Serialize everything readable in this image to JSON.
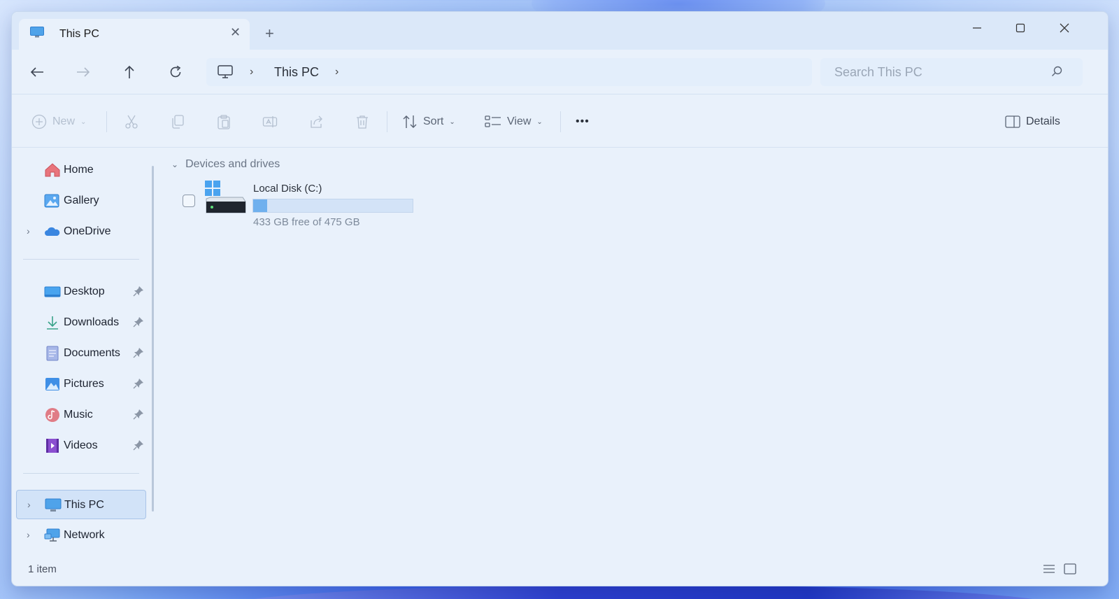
{
  "window": {
    "tab_title": "This PC",
    "tab_icon": "monitor-icon",
    "new_tab_symbol": "+",
    "close_tab_symbol": "✕"
  },
  "address": {
    "path": [
      "This PC"
    ],
    "search_placeholder": "Search This PC"
  },
  "commandbar": {
    "new_label": "New",
    "sort_label": "Sort",
    "view_label": "View",
    "more_symbol": "•••",
    "details_label": "Details"
  },
  "sidebar": {
    "quick": [
      {
        "label": "Home",
        "icon": "home-icon"
      },
      {
        "label": "Gallery",
        "icon": "gallery-icon"
      },
      {
        "label": "OneDrive",
        "icon": "onedrive-cloud-icon"
      }
    ],
    "pinned": [
      {
        "label": "Desktop",
        "icon": "desktop-folder-icon"
      },
      {
        "label": "Downloads",
        "icon": "downloads-icon"
      },
      {
        "label": "Documents",
        "icon": "documents-icon"
      },
      {
        "label": "Pictures",
        "icon": "pictures-icon"
      },
      {
        "label": "Music",
        "icon": "music-icon"
      },
      {
        "label": "Videos",
        "icon": "videos-icon"
      }
    ],
    "locations": [
      {
        "label": "This PC",
        "icon": "monitor-icon",
        "selected": true
      },
      {
        "label": "Network",
        "icon": "network-icon",
        "selected": false
      }
    ]
  },
  "content": {
    "group_label": "Devices and drives",
    "drives": [
      {
        "name": "Local Disk (C:)",
        "free_text": "433 GB free of 475 GB",
        "used_fraction": 0.088
      }
    ]
  },
  "status": {
    "item_count": "1 item"
  },
  "colors": {
    "accent": "#6fb0ee",
    "window_bg": "#e9f1fb",
    "selected_bg": "#d2e3f8"
  }
}
